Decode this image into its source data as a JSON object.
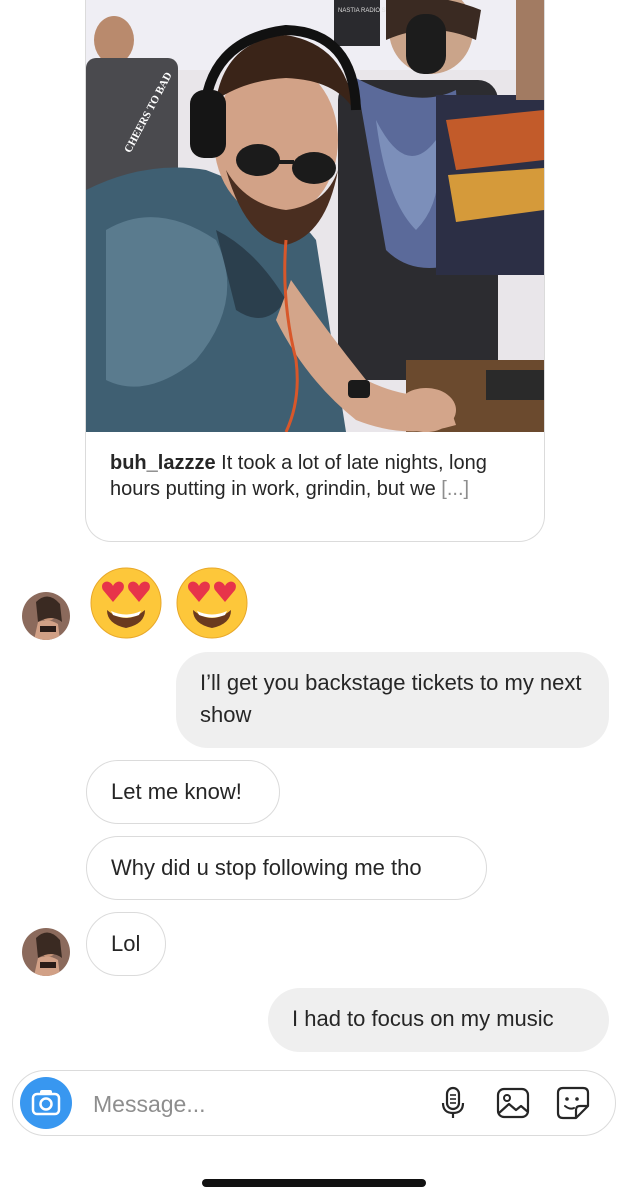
{
  "shared_post": {
    "username": "buh_lazzze",
    "caption": "It took a lot of late nights, long hours putting in work, grindin, but we",
    "more": "[...]",
    "photo_sign_text": "NASTIA RADIO SF",
    "shirt_text": "CHEERS TO BAD"
  },
  "messages": [
    {
      "kind": "emoji",
      "from": "them",
      "content": "😍😍"
    },
    {
      "kind": "text",
      "from": "me",
      "content": "I’ll get you backstage tickets to my next show"
    },
    {
      "kind": "text",
      "from": "them",
      "content": "Let me know!"
    },
    {
      "kind": "text",
      "from": "them",
      "content": "Why did u stop following me tho"
    },
    {
      "kind": "text",
      "from": "them",
      "content": "Lol"
    },
    {
      "kind": "text",
      "from": "me",
      "content": "I had to focus on my music"
    }
  ],
  "composer": {
    "placeholder": "Message...",
    "icons": [
      "camera-icon",
      "microphone-icon",
      "gallery-icon",
      "sticker-icon"
    ]
  },
  "colors": {
    "accent": "#3897f0",
    "sent_bubble": "#efefef",
    "border": "#dbdbdb",
    "muted_text": "#8e8e8e"
  }
}
